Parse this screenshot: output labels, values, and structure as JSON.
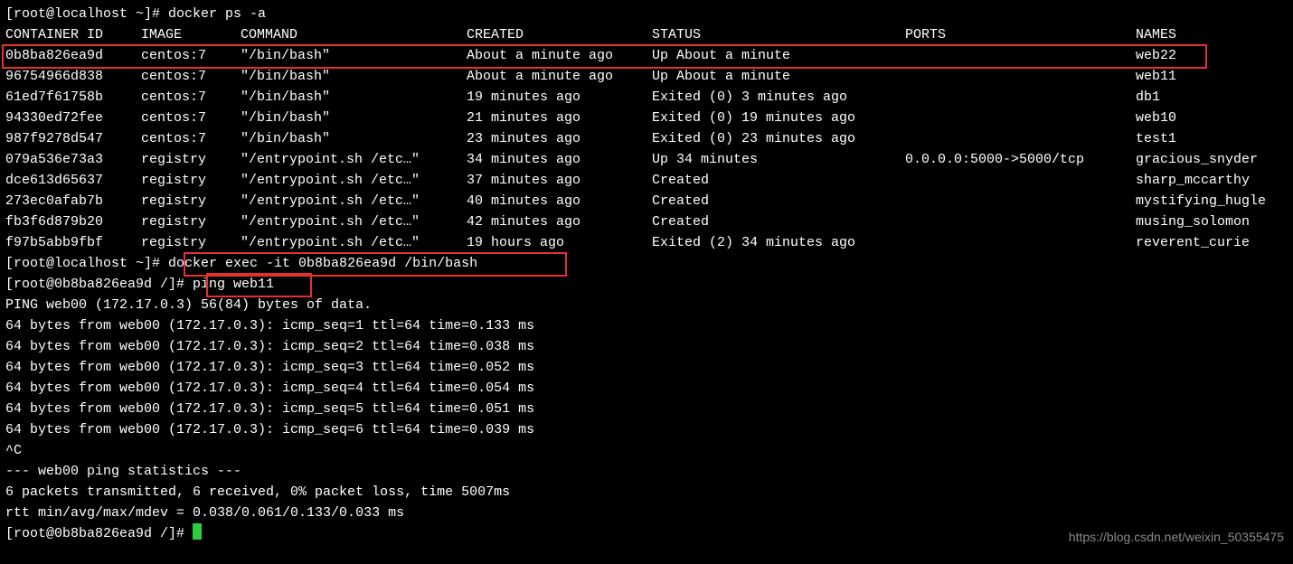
{
  "prompt1": "[root@localhost ~]# ",
  "cmd1": "docker ps -a",
  "headers": {
    "id": "CONTAINER ID",
    "image": "IMAGE",
    "command": "COMMAND",
    "created": "CREATED",
    "status": "STATUS",
    "ports": "PORTS",
    "names": "NAMES"
  },
  "rows": [
    {
      "id": "0b8ba826ea9d",
      "image": "centos:7",
      "command": "\"/bin/bash\"",
      "created": "About a minute ago",
      "status": "Up About a minute",
      "ports": "",
      "names": "web22"
    },
    {
      "id": "96754966d838",
      "image": "centos:7",
      "command": "\"/bin/bash\"",
      "created": "About a minute ago",
      "status": "Up About a minute",
      "ports": "",
      "names": "web11"
    },
    {
      "id": "61ed7f61758b",
      "image": "centos:7",
      "command": "\"/bin/bash\"",
      "created": "19 minutes ago",
      "status": "Exited (0) 3 minutes ago",
      "ports": "",
      "names": "db1"
    },
    {
      "id": "94330ed72fee",
      "image": "centos:7",
      "command": "\"/bin/bash\"",
      "created": "21 minutes ago",
      "status": "Exited (0) 19 minutes ago",
      "ports": "",
      "names": "web10"
    },
    {
      "id": "987f9278d547",
      "image": "centos:7",
      "command": "\"/bin/bash\"",
      "created": "23 minutes ago",
      "status": "Exited (0) 23 minutes ago",
      "ports": "",
      "names": "test1"
    },
    {
      "id": "079a536e73a3",
      "image": "registry",
      "command": "\"/entrypoint.sh /etc…\"",
      "created": "34 minutes ago",
      "status": "Up 34 minutes",
      "ports": "0.0.0.0:5000->5000/tcp",
      "names": "gracious_snyder"
    },
    {
      "id": "dce613d65637",
      "image": "registry",
      "command": "\"/entrypoint.sh /etc…\"",
      "created": "37 minutes ago",
      "status": "Created",
      "ports": "",
      "names": "sharp_mccarthy"
    },
    {
      "id": "273ec0afab7b",
      "image": "registry",
      "command": "\"/entrypoint.sh /etc…\"",
      "created": "40 minutes ago",
      "status": "Created",
      "ports": "",
      "names": "mystifying_hugle"
    },
    {
      "id": "fb3f6d879b20",
      "image": "registry",
      "command": "\"/entrypoint.sh /etc…\"",
      "created": "42 minutes ago",
      "status": "Created",
      "ports": "",
      "names": "musing_solomon"
    },
    {
      "id": "f97b5abb9fbf",
      "image": "registry",
      "command": "\"/entrypoint.sh /etc…\"",
      "created": "19 hours ago",
      "status": "Exited (2) 34 minutes ago",
      "ports": "",
      "names": "reverent_curie"
    }
  ],
  "prompt2": "[root@localhost ~]# ",
  "cmd2": "docker exec -it 0b8ba826ea9d /bin/bash",
  "prompt3": "[root@0b8ba826ea9d /]# ",
  "cmd3": "ping web11",
  "ping_header": "PING web00 (172.17.0.3) 56(84) bytes of data.",
  "ping_lines": [
    "64 bytes from web00 (172.17.0.3): icmp_seq=1 ttl=64 time=0.133 ms",
    "64 bytes from web00 (172.17.0.3): icmp_seq=2 ttl=64 time=0.038 ms",
    "64 bytes from web00 (172.17.0.3): icmp_seq=3 ttl=64 time=0.052 ms",
    "64 bytes from web00 (172.17.0.3): icmp_seq=4 ttl=64 time=0.054 ms",
    "64 bytes from web00 (172.17.0.3): icmp_seq=5 ttl=64 time=0.051 ms",
    "64 bytes from web00 (172.17.0.3): icmp_seq=6 ttl=64 time=0.039 ms"
  ],
  "sigint": "^C",
  "stats_header": "--- web00 ping statistics ---",
  "stats1": "6 packets transmitted, 6 received, 0% packet loss, time 5007ms",
  "stats2": "rtt min/avg/max/mdev = 0.038/0.061/0.133/0.033 ms",
  "prompt4": "[root@0b8ba826ea9d /]# ",
  "watermark": "https://blog.csdn.net/weixin_50355475"
}
